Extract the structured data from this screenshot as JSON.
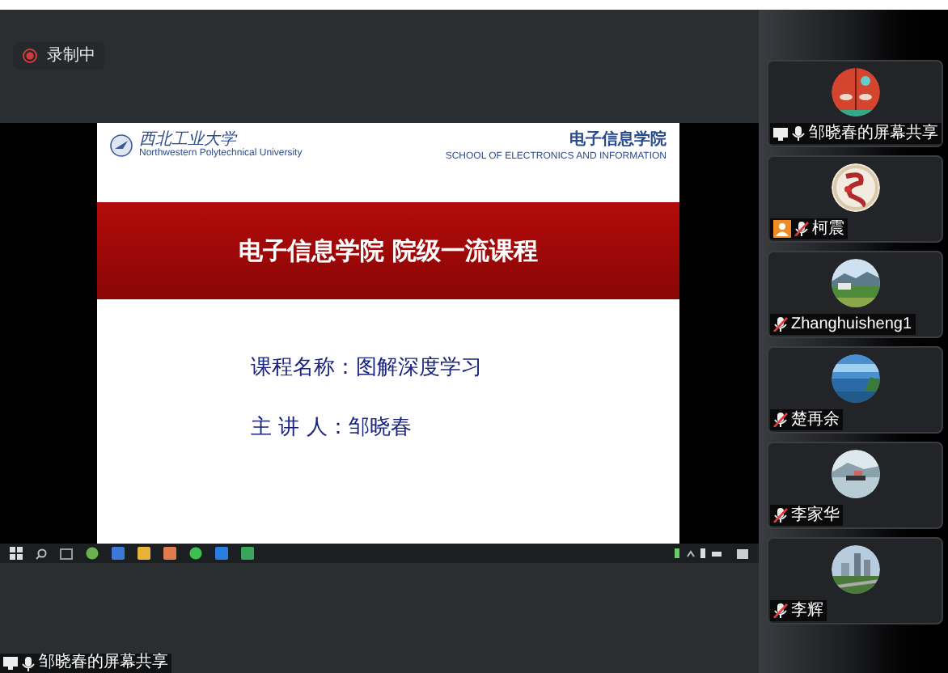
{
  "recording": {
    "label": "录制中"
  },
  "slide": {
    "university": "西北工业大学",
    "university_en": "Northwestern Polytechnical University",
    "school": "电子信息学院",
    "school_en": "SCHOOL OF ELECTRONICS AND INFORMATION",
    "title": "电子信息学院 院级一流课程",
    "lines": [
      "课程名称：图解深度学习",
      "主 讲 人：邹晓春"
    ]
  },
  "share_label": {
    "name": "邹晓春的屏幕共享",
    "muted": false
  },
  "participants": [
    {
      "name": "邹晓春的屏幕共享",
      "muted": false,
      "sharing": true,
      "host": false
    },
    {
      "name": "柯震",
      "muted": true,
      "sharing": false,
      "host": true
    },
    {
      "name": "Zhanghuisheng1",
      "muted": true,
      "sharing": false,
      "host": false
    },
    {
      "name": "楚再余",
      "muted": true,
      "sharing": false,
      "host": false
    },
    {
      "name": "李家华",
      "muted": true,
      "sharing": false,
      "host": false
    },
    {
      "name": "李辉",
      "muted": true,
      "sharing": false,
      "host": false
    }
  ]
}
